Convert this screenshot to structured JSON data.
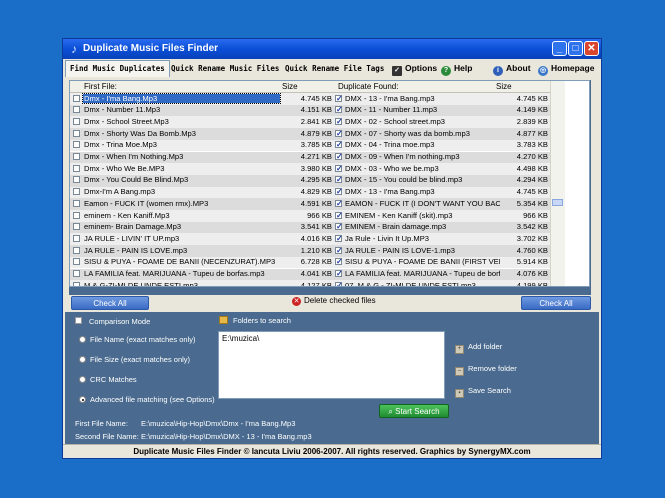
{
  "window": {
    "title": "Duplicate Music Files Finder"
  },
  "tabs": [
    {
      "label": "Find Music Duplicates",
      "active": true
    },
    {
      "label": "Quick Rename Music Files",
      "active": false
    },
    {
      "label": "Quick Rename File Tags",
      "active": false
    }
  ],
  "toplinks": [
    {
      "label": "Options",
      "icon": "checkbox-icon"
    },
    {
      "label": "Help",
      "icon": "help-icon"
    },
    {
      "label": "About",
      "icon": "info-icon"
    },
    {
      "label": "Homepage",
      "icon": "globe-icon"
    }
  ],
  "grid": {
    "headers": {
      "first_file": "First File:",
      "size1": "Size",
      "duplicate_found": "Duplicate Found:",
      "size2": "Size"
    },
    "rows": [
      {
        "f": "Dmx - I'ma Bang.Mp3",
        "s1": "4.745 KB",
        "d": "DMX - 13 - I'ma Bang.mp3",
        "s2": "4.745 KB",
        "selected": true
      },
      {
        "f": "Dmx - Number 11.Mp3",
        "s1": "4.151 KB",
        "d": "DMX - 11 - Number 11.mp3",
        "s2": "4.149 KB"
      },
      {
        "f": "Dmx - School Street.Mp3",
        "s1": "2.841 KB",
        "d": "DMX - 02 - School street.mp3",
        "s2": "2.839 KB"
      },
      {
        "f": "Dmx - Shorty Was Da Bomb.Mp3",
        "s1": "4.879 KB",
        "d": "DMX - 07 - Shorty was da bomb.mp3",
        "s2": "4.877 KB"
      },
      {
        "f": "Dmx - Trina Moe.Mp3",
        "s1": "3.785 KB",
        "d": "DMX - 04 - Trina moe.mp3",
        "s2": "3.783 KB"
      },
      {
        "f": "Dmx - When I'm Nothing.Mp3",
        "s1": "4.271 KB",
        "d": "DMX - 09 - When I'm nothing.mp3",
        "s2": "4.270 KB"
      },
      {
        "f": "Dmx - Who We Be.MP3",
        "s1": "3.980 KB",
        "d": "DMX - 03 - Who we be.mp3",
        "s2": "4.498 KB"
      },
      {
        "f": "Dmx - You Could Be Blind.Mp3",
        "s1": "4.295 KB",
        "d": "DMX - 15 - You could be blind.mp3",
        "s2": "4.294 KB"
      },
      {
        "f": "Dmx-I'm A Bang.mp3",
        "s1": "4.829 KB",
        "d": "DMX - 13 - I'ma Bang.mp3",
        "s2": "4.745 KB"
      },
      {
        "f": "Eamon - FUCK IT (women rmx).MP3",
        "s1": "4.591 KB",
        "d": "EAMON - FUCK IT (I DON'T WANT YOU BACK).mp3",
        "s2": "5.354 KB"
      },
      {
        "f": "eminem - Ken Kaniff.Mp3",
        "s1": "966 KB",
        "d": "EMINEM - Ken Kaniff (skit).mp3",
        "s2": "966 KB"
      },
      {
        "f": "eminem- Brain Damage.Mp3",
        "s1": "3.541 KB",
        "d": "EMINEM - Brain damage.mp3",
        "s2": "3.542 KB"
      },
      {
        "f": "JA RULE - LIVIN' IT UP.mp3",
        "s1": "4.016 KB",
        "d": "Ja Rule - Livin It Up.MP3",
        "s2": "3.702 KB"
      },
      {
        "f": "JA RULE - PAIN IS LOVE.mp3",
        "s1": "1.210 KB",
        "d": "JA RULE - PAIN IS LOVE-1.mp3",
        "s2": "4.760 KB"
      },
      {
        "f": "SISU & PUYA - FOAME DE BANII (NECENZURAT).MP3",
        "s1": "6.728 KB",
        "d": "SISU & PUYA - FOAME DE BANII (FIRST VERSION",
        "s2": "5.914 KB"
      },
      {
        "f": "LA FAMILIA feat. MARIJUANA - Tupeu de borfas.mp3",
        "s1": "4.041 KB",
        "d": "LA FAMILIA feat. MARIJUANA - Tupeu de borfas",
        "s2": "4.076 KB"
      },
      {
        "f": "M & G-ZI-MI DE UNDE ESTI.mp3",
        "s1": "4.127 KB",
        "d": "07_M & G - ZI-MI DE UNDE ESTI.mp3",
        "s2": "4.199 KB"
      }
    ]
  },
  "buttons": {
    "check_all_left": "Check All",
    "check_all_right": "Check All",
    "delete_checked": "Delete checked files",
    "start_search": "Start Search"
  },
  "comparison": {
    "title": "Comparison Mode",
    "options": [
      {
        "label": "File Name (exact matches only)",
        "selected": false
      },
      {
        "label": "File Size (exact matches only)",
        "selected": false
      },
      {
        "label": "CRC Matches",
        "selected": false
      },
      {
        "label": "Advanced file matching (see Options)",
        "selected": true
      }
    ]
  },
  "folders": {
    "title": "Folders to search",
    "items": [
      "E:\\muzica\\"
    ]
  },
  "folder_actions": {
    "add": "Add folder",
    "remove": "Remove folder",
    "save": "Save Search"
  },
  "details": {
    "first_label": "First File Name:",
    "first_value": "E:\\muzica\\Hip-Hop\\Dmx\\Dmx - I'ma Bang.Mp3",
    "second_label": "Second File Name:",
    "second_value": "E:\\muzica\\Hip-Hop\\Dmx\\DMX - 13 - I'ma Bang.mp3"
  },
  "status": {
    "text": "Duplicate Music Files Finder © Iancuta Liviu 2006-2007. All rights reserved. Graphics by SynergyMX.com"
  }
}
